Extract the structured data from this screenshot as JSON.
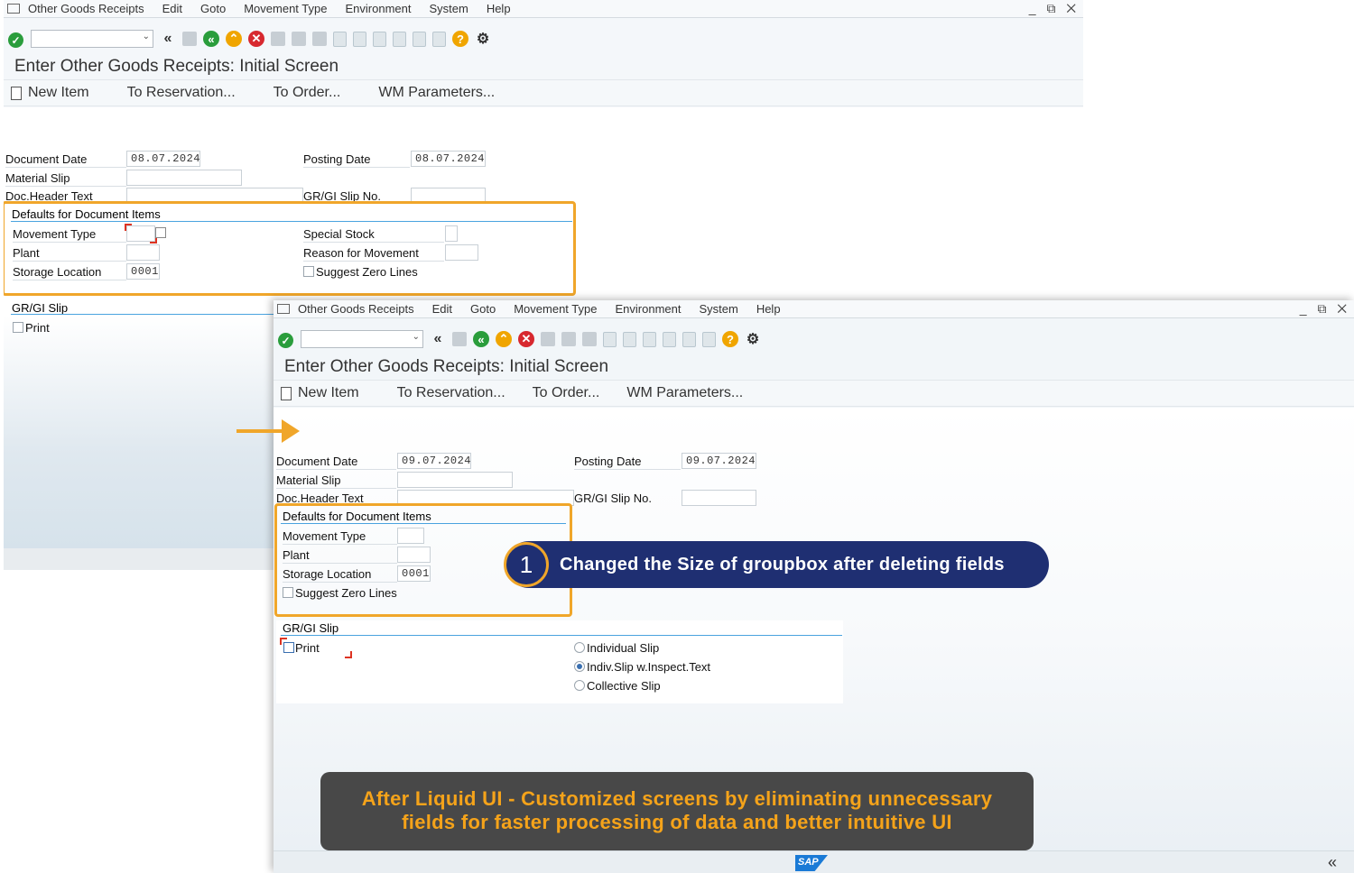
{
  "menu": {
    "app": "Other Goods Receipts",
    "items": [
      "Edit",
      "Goto",
      "Movement Type",
      "Environment",
      "System",
      "Help"
    ]
  },
  "window_controls": "_ ⧉ ✕",
  "title": "Enter Other Goods Receipts: Initial Screen",
  "app_toolbar": {
    "new_item": "New Item",
    "to_reservation": "To Reservation...",
    "to_order": "To Order...",
    "wm_parameters": "WM Parameters..."
  },
  "icons": {
    "enter": "check-icon",
    "back": "back-icon",
    "exit": "exit-icon",
    "cancel": "cancel-icon",
    "help": "help-icon",
    "settings": "gear-icon",
    "brand_color": "#1f2f72",
    "accent_color": "#f0a62a"
  },
  "before": {
    "document_date_label": "Document Date",
    "document_date": "08.07.2024",
    "posting_date_label": "Posting Date",
    "posting_date": "08.07.2024",
    "material_slip_label": "Material Slip",
    "doc_header_text_label": "Doc.Header Text",
    "gr_gi_slip_no_label": "GR/GI Slip No.",
    "defaults_group_title": "Defaults for Document Items",
    "movement_type_label": "Movement Type",
    "plant_label": "Plant",
    "storage_location_label": "Storage Location",
    "storage_location": "0001",
    "special_stock_label": "Special Stock",
    "reason_for_movement_label": "Reason for Movement",
    "suggest_zero_lines_label": "Suggest Zero Lines",
    "gr_gi_slip_group_title": "GR/GI Slip",
    "print_label": "Print"
  },
  "after": {
    "document_date_label": "Document Date",
    "document_date": "09.07.2024",
    "posting_date_label": "Posting Date",
    "posting_date": "09.07.2024",
    "material_slip_label": "Material Slip",
    "doc_header_text_label": "Doc.Header Text",
    "gr_gi_slip_no_label": "GR/GI Slip No.",
    "defaults_group_title": "Defaults for Document Items",
    "movement_type_label": "Movement Type",
    "plant_label": "Plant",
    "storage_location_label": "Storage Location",
    "storage_location": "0001",
    "suggest_zero_lines_label": "Suggest Zero Lines",
    "gr_gi_slip_group_title": "GR/GI Slip",
    "print_label": "Print",
    "individual_slip": "Individual Slip",
    "indiv_slip_inspect": "Indiv.Slip w.Inspect.Text",
    "collective_slip": "Collective Slip",
    "selected_slip": "Indiv.Slip w.Inspect.Text"
  },
  "callout": {
    "number": "1",
    "text": "Changed the Size of groupbox after deleting fields"
  },
  "banner": {
    "line1": "After Liquid UI - Customized screens by eliminating unnecessary",
    "line2": "fields for faster processing of data and better intuitive UI"
  },
  "sap_logo": "SAP"
}
